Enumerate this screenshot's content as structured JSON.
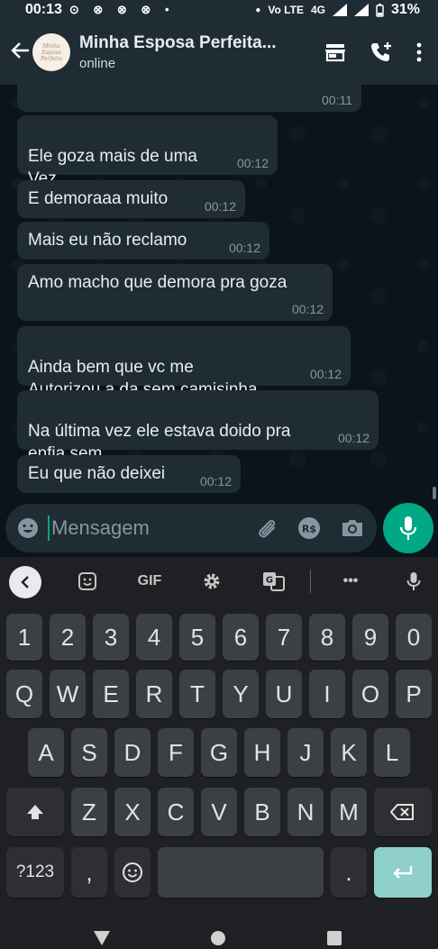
{
  "status_bar": {
    "time": "00:13",
    "network_label": "Vo LTE",
    "network_type": "4G",
    "battery": "31%"
  },
  "header": {
    "back_icon": "arrow-left-icon",
    "avatar_text": "Minha Esposa Perfeita",
    "title": "Minha Esposa Perfeita...",
    "subtitle": "online"
  },
  "messages": [
    {
      "text": "",
      "time": "00:11"
    },
    {
      "text": "Ele goza mais de uma\nVez",
      "time": "00:12"
    },
    {
      "text": "E demoraaa muito",
      "time": "00:12"
    },
    {
      "text": "Mais eu não reclamo",
      "time": "00:12"
    },
    {
      "text": "Amo macho que demora pra goza",
      "time": "00:12"
    },
    {
      "text": "Ainda bem que vc me\nAutorizou a da sem camisinha",
      "time": "00:12"
    },
    {
      "text": "Na última vez ele estava doido pra\nenfia sem",
      "time": "00:12"
    },
    {
      "text": "Eu que não deixei",
      "time": "00:12"
    }
  ],
  "input": {
    "placeholder": "Mensagem"
  },
  "keyboard": {
    "toolbar": {
      "gif": "GIF",
      "more": "•••"
    },
    "row_numbers": [
      "1",
      "2",
      "3",
      "4",
      "5",
      "6",
      "7",
      "8",
      "9",
      "0"
    ],
    "row_top": [
      "Q",
      "W",
      "E",
      "R",
      "T",
      "Y",
      "U",
      "I",
      "O",
      "P"
    ],
    "row_middle": [
      "A",
      "S",
      "D",
      "F",
      "G",
      "H",
      "J",
      "K",
      "L"
    ],
    "row_bottom": [
      "Z",
      "X",
      "C",
      "V",
      "B",
      "N",
      "M"
    ],
    "symbols_key": "?123",
    "comma": ",",
    "period": "."
  }
}
